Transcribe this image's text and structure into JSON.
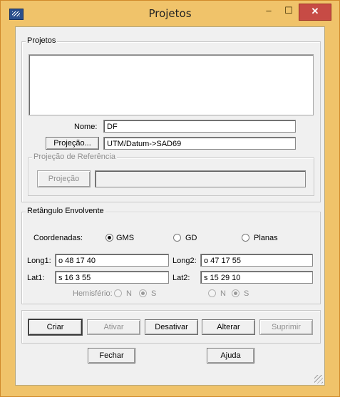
{
  "window": {
    "title": "Projetos",
    "minimize": "–",
    "maximize": "☐",
    "close": "✕"
  },
  "projetos": {
    "legend": "Projetos",
    "nome_label": "Nome:",
    "nome_value": "DF",
    "projecao_button": "Projeção...",
    "projecao_value": "UTM/Datum->SAD69"
  },
  "referencia": {
    "legend": "Projeção de Referência",
    "projecao_button": "Projeção",
    "projecao_value": ""
  },
  "retangulo": {
    "legend": "Retângulo Envolvente",
    "coordenadas_label": "Coordenadas:",
    "options": [
      "GMS",
      "GD",
      "Planas"
    ],
    "selected": "GMS",
    "long1_label": "Long1:",
    "long1_value": "o 48 17 40",
    "lat1_label": "Lat1:",
    "lat1_value": "s 16 3 55",
    "long2_label": "Long2:",
    "long2_value": "o 47 17 55",
    "lat2_label": "Lat2:",
    "lat2_value": "s 15 29 10",
    "hemisferio_label": "Hemisfério:",
    "hemisferio_n": "N",
    "hemisferio_s": "S"
  },
  "actions": {
    "criar": "Criar",
    "ativar": "Ativar",
    "desativar": "Desativar",
    "alterar": "Alterar",
    "suprimir": "Suprimir"
  },
  "footer": {
    "fechar": "Fechar",
    "ajuda": "Ajuda"
  }
}
